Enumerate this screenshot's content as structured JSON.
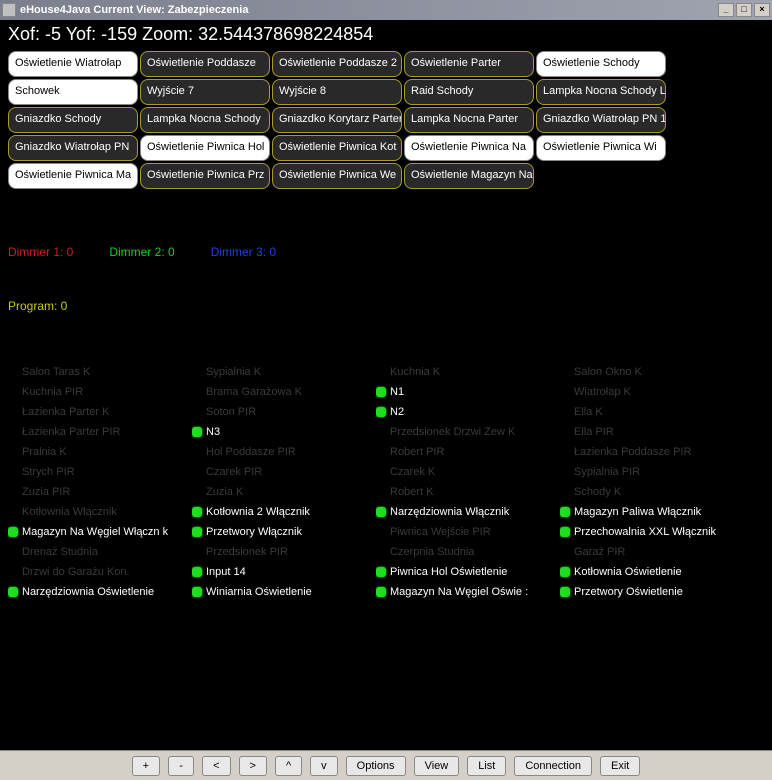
{
  "window": {
    "title": "eHouse4Java Current View:   Zabezpieczenia"
  },
  "status": {
    "xof": -5,
    "yof": -159,
    "zoom": 32.544378698224854,
    "text": "Xof: -5 Yof: -159 Zoom: 32.544378698224854"
  },
  "rooms": [
    {
      "label": "Oświetlenie Wiatrołap",
      "active": true
    },
    {
      "label": "Oświetlenie Poddasze",
      "active": false
    },
    {
      "label": "Oświetlenie Poddasze 2",
      "active": false
    },
    {
      "label": "Oświetlenie Parter",
      "active": false
    },
    {
      "label": "Oświetlenie Schody",
      "active": true
    },
    {
      "label": "Schowek",
      "active": true
    },
    {
      "label": "Wyjście 7",
      "active": false
    },
    {
      "label": "Wyjście 8",
      "active": false
    },
    {
      "label": "Raid Schody",
      "active": false
    },
    {
      "label": "Lampka Nocna Schody L",
      "active": false
    },
    {
      "label": "Gniazdko Schody",
      "active": false
    },
    {
      "label": "Lampka Nocna Schody",
      "active": false
    },
    {
      "label": "Gniazdko Korytarz Parter",
      "active": false
    },
    {
      "label": "Lampka Nocna Parter",
      "active": false
    },
    {
      "label": "Gniazdko Wiatrołap PN 1",
      "active": false
    },
    {
      "label": "Gniazdko Wiatrołap PN",
      "active": false
    },
    {
      "label": "Oświetlenie Piwnica Hol",
      "active": true
    },
    {
      "label": "Oświetlenie Piwnica Kot",
      "active": false
    },
    {
      "label": "Oświetlenie Piwnica Na",
      "active": true
    },
    {
      "label": "Oświetlenie Piwnica Wi",
      "active": true
    },
    {
      "label": "Oświetlenie Piwnica Ma",
      "active": true
    },
    {
      "label": "Oświetlenie Piwnica Prz",
      "active": false
    },
    {
      "label": "Oświetlenie Piwnica We",
      "active": false
    },
    {
      "label": "Oświetlenie Magazyn Narzędzia",
      "active": false
    }
  ],
  "dimmers": {
    "d1": "Dimmer 1: 0",
    "d2": "Dimmer 2: 0",
    "d3": "Dimmer 3: 0"
  },
  "program": "Program: 0",
  "signals": {
    "cols": 4,
    "items": [
      {
        "label": "Salon Taras K",
        "on": false
      },
      {
        "label": "Sypialnia K",
        "on": false
      },
      {
        "label": "Kuchnia K",
        "on": false
      },
      {
        "label": "Salon Okno K",
        "on": false
      },
      {
        "label": "Kuchnia PIR",
        "on": false
      },
      {
        "label": "Brama Garażowa K",
        "on": false
      },
      {
        "label": "N1",
        "on": true
      },
      {
        "label": "Wiatrołap K",
        "on": false
      },
      {
        "label": "Łazienka Parter K",
        "on": false
      },
      {
        "label": "Soton PIR",
        "on": false
      },
      {
        "label": "N2",
        "on": true
      },
      {
        "label": "Ella K",
        "on": false
      },
      {
        "label": "Łazienka Parter PIR",
        "on": false
      },
      {
        "label": "N3",
        "on": true
      },
      {
        "label": "Przedsionek Drzwi Zew K",
        "on": false
      },
      {
        "label": "Ella PIR",
        "on": false
      },
      {
        "label": "Pralnia K",
        "on": false
      },
      {
        "label": "Hol Poddasze PIR",
        "on": false
      },
      {
        "label": "Robert PIR",
        "on": false
      },
      {
        "label": "Łazienka Poddasze PIR",
        "on": false
      },
      {
        "label": "Strych PIR",
        "on": false
      },
      {
        "label": "Czarek PIR",
        "on": false
      },
      {
        "label": "Czarek K",
        "on": false
      },
      {
        "label": "Sypialnia PIR",
        "on": false
      },
      {
        "label": "Zuzia PIR",
        "on": false
      },
      {
        "label": "Zuzia K",
        "on": false
      },
      {
        "label": "Robert K",
        "on": false
      },
      {
        "label": "Schody K",
        "on": false
      },
      {
        "label": "Kotłownia Włącznik",
        "on": false
      },
      {
        "label": "Kotłownia 2 Włącznik",
        "on": true
      },
      {
        "label": "Narzędziownia Włącznik",
        "on": true
      },
      {
        "label": "Magazyn Paliwa Włącznik",
        "on": true
      },
      {
        "label": "Magazyn Na Węgiel Włączn k",
        "on": true
      },
      {
        "label": "Przetwory Włącznik",
        "on": true
      },
      {
        "label": "Piwnica Wejście PIR",
        "on": false
      },
      {
        "label": "Przechowalnia XXL Włącznik",
        "on": true
      },
      {
        "label": "Drenaż Studnia",
        "on": false
      },
      {
        "label": "Przedsionek PIR",
        "on": false
      },
      {
        "label": "Czerpnia Studnia",
        "on": false
      },
      {
        "label": "Garaż PIR",
        "on": false
      },
      {
        "label": "Drzwi do Garażu Kon.",
        "on": false
      },
      {
        "label": "Input 14",
        "on": true
      },
      {
        "label": "Piwnica Hol Oświetlenie",
        "on": true
      },
      {
        "label": "Kotłownia Oświetlenie",
        "on": true
      },
      {
        "label": "Narzędziownia Oświetlenie",
        "on": true
      },
      {
        "label": "Winiarnia Oświetlenie",
        "on": true
      },
      {
        "label": "Magazyn Na Węgiel Oświe  :",
        "on": true
      },
      {
        "label": "Przetwory Oświetlenie",
        "on": true
      }
    ]
  },
  "toolbar": {
    "plus": "+",
    "minus": "-",
    "left": "<",
    "right": ">",
    "up": "^",
    "down": "v",
    "options": "Options",
    "view": "View",
    "list": "List",
    "connection": "Connection",
    "exit": "Exit"
  }
}
